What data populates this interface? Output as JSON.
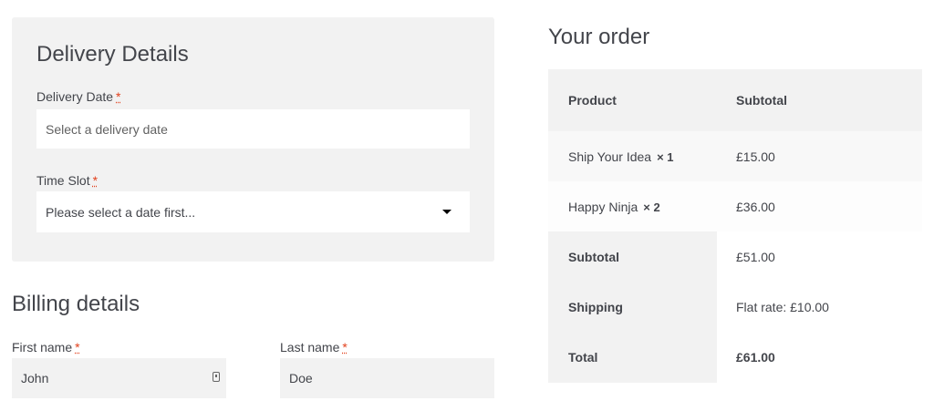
{
  "delivery": {
    "heading": "Delivery Details",
    "date_label": "Delivery Date",
    "date_placeholder": "Select a delivery date",
    "slot_label": "Time Slot",
    "slot_value": "Please select a date first...",
    "required_mark": "*"
  },
  "billing": {
    "heading": "Billing details",
    "first_name_label": "First name",
    "first_name_value": "John",
    "last_name_label": "Last name",
    "last_name_value": "Doe",
    "required_mark": "*"
  },
  "order": {
    "heading": "Your order",
    "col_product": "Product",
    "col_subtotal": "Subtotal",
    "items": [
      {
        "name": "Ship Your Idea",
        "qty": "× 1",
        "price": "£15.00"
      },
      {
        "name": "Happy Ninja",
        "qty": "× 2",
        "price": "£36.00"
      }
    ],
    "subtotal_label": "Subtotal",
    "subtotal_value": "£51.00",
    "shipping_label": "Shipping",
    "shipping_value": "Flat rate: £10.00",
    "total_label": "Total",
    "total_value": "£61.00"
  },
  "colors": {
    "panel_bg": "#f2f2f2",
    "row_alt_bg": "#f8f8f8",
    "required": "#e2401c"
  }
}
